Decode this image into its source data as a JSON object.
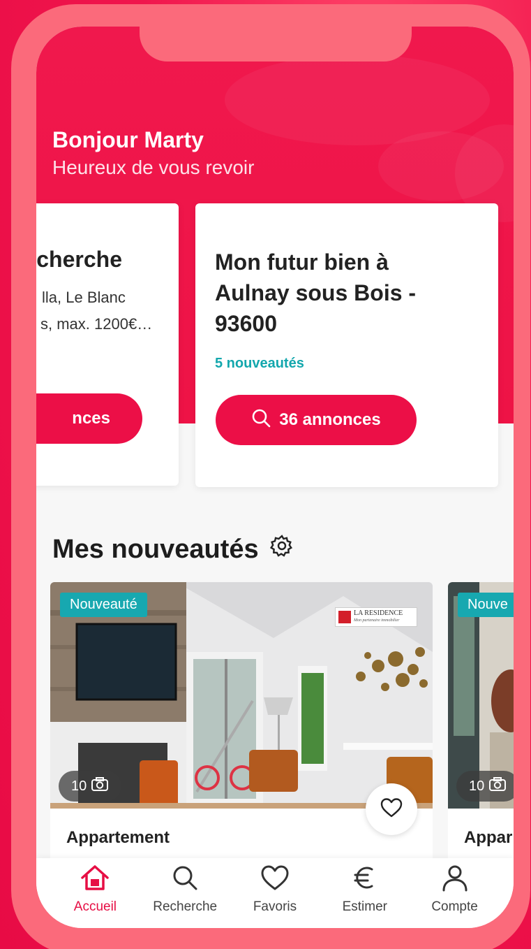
{
  "colors": {
    "accent": "#ec0f47",
    "teal": "#17a8b0",
    "frame": "#fb6a7b"
  },
  "greeting": {
    "title": "Bonjour Marty",
    "subtitle": "Heureux de vous revoir"
  },
  "search_cards": [
    {
      "title": "recherche",
      "line1": "lla, Le Blanc",
      "line2": "s, max. 1200€…",
      "button_label": "nces"
    },
    {
      "title": "Mon futur bien à Aulnay sous Bois - 93600",
      "new_count": "5 nouveautés",
      "button_label": "36 annonces",
      "button_icon": "search-icon"
    }
  ],
  "section": {
    "title": "Mes nouveautés",
    "icon": "gear-icon"
  },
  "listings": [
    {
      "badge": "Nouveauté",
      "agency_logo": "LA RESIDENCE",
      "agency_tagline": "Mon partenaire immobilier",
      "photo_count": "10",
      "title": "Appartement"
    },
    {
      "badge": "Nouve",
      "photo_count": "10",
      "title": "Appar"
    }
  ],
  "tabbar": [
    {
      "label": "Accueil",
      "icon": "home-icon",
      "active": true
    },
    {
      "label": "Recherche",
      "icon": "search-icon",
      "active": false
    },
    {
      "label": "Favoris",
      "icon": "heart-icon",
      "active": false
    },
    {
      "label": "Estimer",
      "icon": "euro-icon",
      "active": false
    },
    {
      "label": "Compte",
      "icon": "user-icon",
      "active": false
    }
  ]
}
